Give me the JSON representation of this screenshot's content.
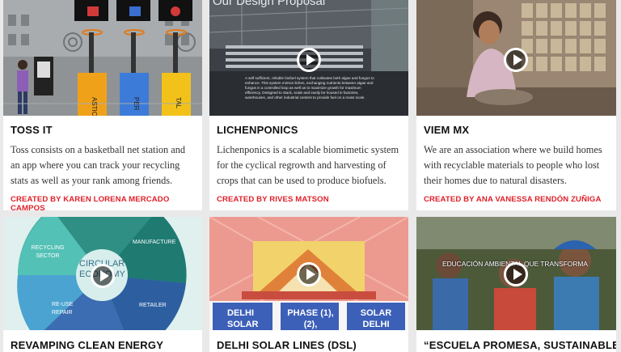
{
  "cards": [
    {
      "title": "TOSS IT",
      "description": "Toss consists on a basketball net station and an app where you can track your recycling stats as well as your rank among friends.",
      "credit": "CREATED BY KAREN LORENA MERCADO CAMPOS",
      "thumb_labels": [
        "ASTIC",
        "PER",
        "TAL"
      ]
    },
    {
      "title": "LICHENPONICS",
      "description": "Lichenponics is a scalable biomimetic system for the cyclical regrowth and harvesting of crops that can be used to produce biofuels.",
      "credit": "CREATED BY RIVES MATSON",
      "thumb_heading": "Our Design Proposal",
      "thumb_caption": "A self sufficient, reliable biofuel system that cultivates both algae and fungus to enhance. This system mimics lichen, exchanging nutrients between algae and fungus in a controlled loop as well as to maximize growth for maximum efficiency. Designed to stack, scale and easily be housed in factories, warehouses, and other industrial centers to provide fuel on a mass scale."
    },
    {
      "title": "VIEM MX",
      "description": "We are an association where we build homes with recyclable materials to people who lost their homes due to natural disasters.",
      "credit": "CREATED BY ANA VANESSA RENDÓN ZUÑIGA"
    },
    {
      "title": "REVAMPING CLEAN ENERGY",
      "thumb_labels": [
        "RECYCLING SECTOR",
        "MANUFACTURE",
        "CIRCULAR ECONOMY",
        "RETAILER",
        "RE-USE REPAIR"
      ]
    },
    {
      "title": "DELHI SOLAR LINES (DSL)",
      "thumb_labels": [
        "DELHI SOLAR",
        "PHASE (1), (2),",
        "SOLAR DELHI"
      ]
    },
    {
      "title": "“ESCUELA PROMESA, SUSTAINABLE",
      "thumb_caption": "EDUCACIÓN AMBIENTAL QUE TRANSFORMA"
    }
  ],
  "icons": [
    "play-icon"
  ],
  "colors": {
    "credit": "#e0202a",
    "background": "#e9e9e9",
    "card": "#ffffff"
  }
}
